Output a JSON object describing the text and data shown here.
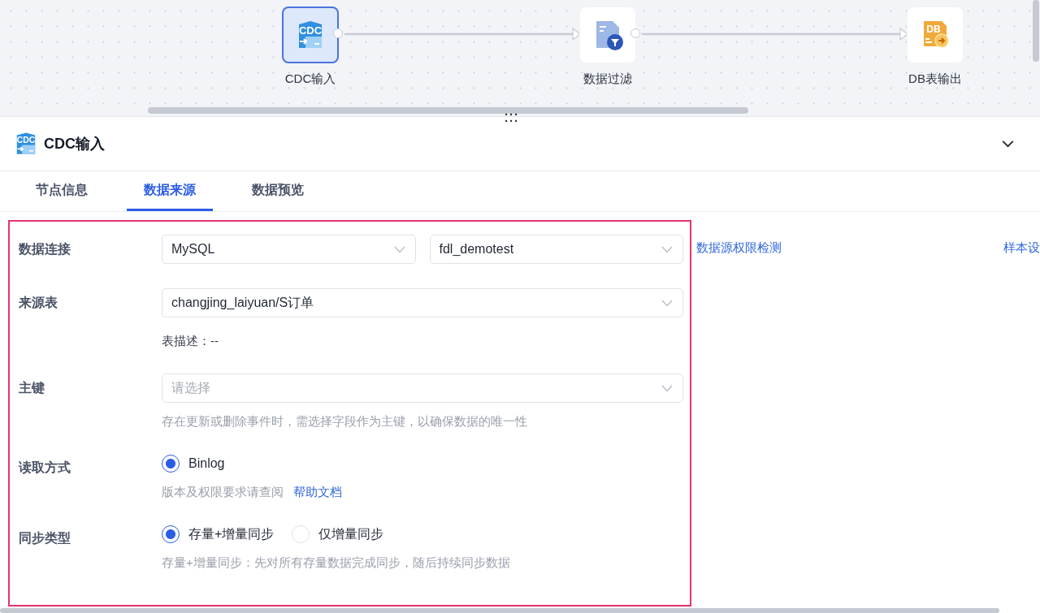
{
  "canvas": {
    "nodes": [
      {
        "label": "CDC输入",
        "kind": "cdc",
        "badge": "CDC",
        "selected": true
      },
      {
        "label": "数据过滤",
        "kind": "filter",
        "selected": false
      },
      {
        "label": "DB表输出",
        "kind": "db",
        "badge": "DB",
        "selected": false
      }
    ]
  },
  "panel": {
    "title": "CDC输入",
    "title_badge": "CDC",
    "tabs": [
      {
        "label": "节点信息",
        "selected": false
      },
      {
        "label": "数据来源",
        "selected": true
      },
      {
        "label": "数据预览",
        "selected": false
      }
    ],
    "form": {
      "rows": [
        {
          "label": "数据连接",
          "kind": "select",
          "fields": [
            {
              "value": "MySQL"
            },
            {
              "value": "fdl_demotest"
            }
          ]
        },
        {
          "label": "来源表",
          "kind": "select",
          "fields": [
            {
              "value": "changjing_laiyuan/S订单"
            }
          ],
          "note": "表描述：--"
        },
        {
          "label": "主键",
          "kind": "select",
          "fields": [
            {
              "placeholder": "请选择"
            }
          ],
          "hint": "存在更新或删除事件时，需选择字段作为主键，以确保数据的唯一性"
        },
        {
          "label": "读取方式",
          "kind": "radios",
          "options": [
            {
              "label": "Binlog",
              "selected": true
            }
          ],
          "hint": "版本及权限要求请查阅",
          "link": "帮助文档"
        },
        {
          "label": "同步类型",
          "kind": "radios",
          "options": [
            {
              "label": "存量+增量同步",
              "selected": true
            },
            {
              "label": "仅增量同步",
              "selected": false
            }
          ],
          "hint": "存量+增量同步：先对所有存量数据完成同步，随后持续同步数据"
        }
      ]
    },
    "side_links": [
      "数据源权限检测",
      "样本设"
    ]
  }
}
